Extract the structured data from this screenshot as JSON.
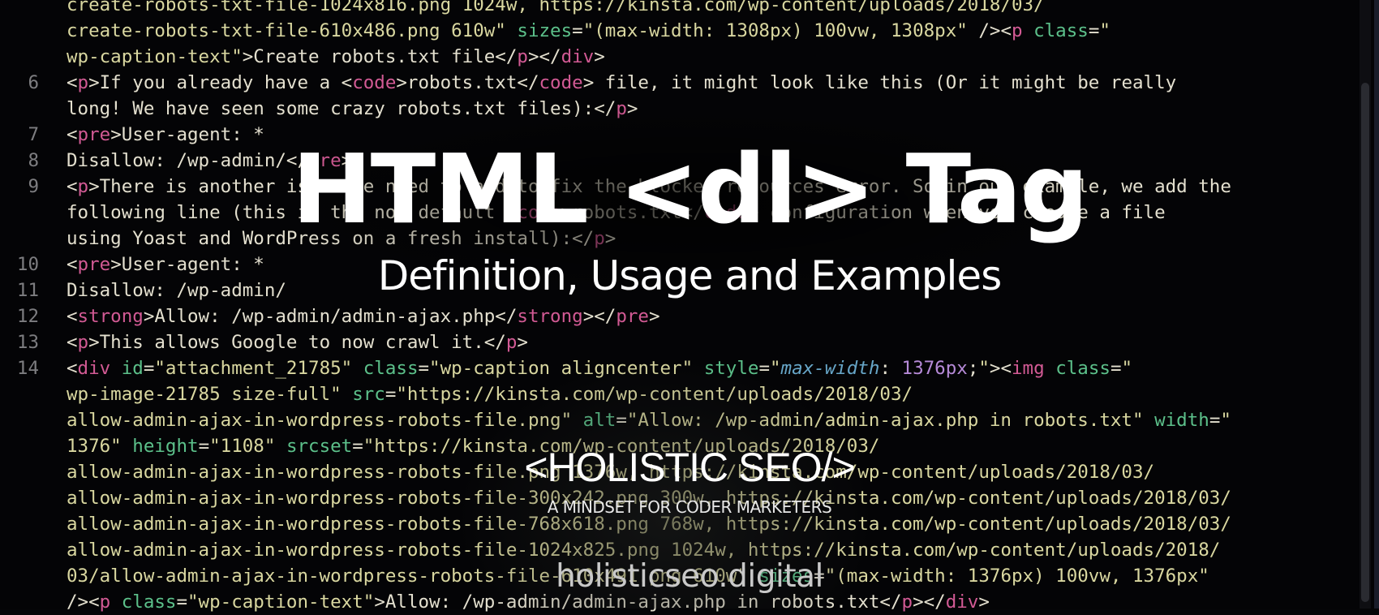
{
  "banner": {
    "title": "HTML <dl> Tag",
    "subtitle": "Definition, Usage and Examples",
    "brand": "<HOLISTIC SEO/>",
    "tagline": "A MINDSET FOR CODER  MARKETERS",
    "domain": "holisticseo.digital"
  },
  "colors": {
    "background": "#040406",
    "string": "#d9d7a0",
    "tag": "#d25a94",
    "attribute": "#5cc08a",
    "line_number": "#7d7d80",
    "title_text": "#ffffff"
  },
  "code": {
    "lines": [
      {
        "num": "",
        "segments": [
          {
            "c": "s",
            "t": "create-robots-txt-file-1024x816.png 1024w, https://kinsta.com/wp-content/uploads/2018/03/"
          }
        ]
      },
      {
        "num": "",
        "segments": [
          {
            "c": "s",
            "t": "create-robots-txt-file-610x486.png 610w\" "
          },
          {
            "c": "a",
            "t": "sizes"
          },
          {
            "c": "p",
            "t": "="
          },
          {
            "c": "s",
            "t": "\"(max-width: 1308px) 100vw, 1308px\" "
          },
          {
            "c": "p",
            "t": "/><"
          },
          {
            "c": "t",
            "t": "p"
          },
          {
            "c": "a",
            "t": " class"
          },
          {
            "c": "p",
            "t": "="
          },
          {
            "c": "s",
            "t": "\""
          }
        ]
      },
      {
        "num": "",
        "segments": [
          {
            "c": "s",
            "t": "wp-caption-text\""
          },
          {
            "c": "p",
            "t": ">Create robots.txt file</"
          },
          {
            "c": "t",
            "t": "p"
          },
          {
            "c": "p",
            "t": "></"
          },
          {
            "c": "t",
            "t": "div"
          },
          {
            "c": "p",
            "t": ">"
          }
        ]
      },
      {
        "num": "6",
        "segments": [
          {
            "c": "p",
            "t": "<"
          },
          {
            "c": "t",
            "t": "p"
          },
          {
            "c": "p",
            "t": ">If you already have a <"
          },
          {
            "c": "t",
            "t": "code"
          },
          {
            "c": "p",
            "t": ">robots.txt</"
          },
          {
            "c": "t",
            "t": "code"
          },
          {
            "c": "p",
            "t": "> file, it might look like this (Or it might be really"
          }
        ]
      },
      {
        "num": "",
        "segments": [
          {
            "c": "p",
            "t": "long! We have seen some crazy robots.txt files):</"
          },
          {
            "c": "t",
            "t": "p"
          },
          {
            "c": "p",
            "t": ">"
          }
        ]
      },
      {
        "num": "7",
        "segments": [
          {
            "c": "p",
            "t": "<"
          },
          {
            "c": "t",
            "t": "pre"
          },
          {
            "c": "p",
            "t": ">User-agent: *"
          }
        ]
      },
      {
        "num": "8",
        "segments": [
          {
            "c": "p",
            "t": "Disallow: /wp-admin/</"
          },
          {
            "c": "t",
            "t": "pre"
          },
          {
            "c": "p",
            "t": ">"
          }
        ]
      },
      {
        "num": "9",
        "segments": [
          {
            "c": "p",
            "t": "<"
          },
          {
            "c": "t",
            "t": "p"
          },
          {
            "c": "p",
            "t": ">There is another issue we need to add to fix the blocked resources error. So in our example, we add the"
          }
        ]
      },
      {
        "num": "",
        "segments": [
          {
            "c": "p",
            "t": "following line (this is the now default <"
          },
          {
            "c": "t",
            "t": "code"
          },
          {
            "c": "p",
            "t": ">robots.txt</"
          },
          {
            "c": "t",
            "t": "code"
          },
          {
            "c": "p",
            "t": "> configuration when you create a file"
          }
        ]
      },
      {
        "num": "",
        "segments": [
          {
            "c": "p",
            "t": "using Yoast and WordPress on a fresh install):</"
          },
          {
            "c": "t",
            "t": "p"
          },
          {
            "c": "p",
            "t": ">"
          }
        ]
      },
      {
        "num": "10",
        "segments": [
          {
            "c": "p",
            "t": "<"
          },
          {
            "c": "t",
            "t": "pre"
          },
          {
            "c": "p",
            "t": ">User-agent: *"
          }
        ]
      },
      {
        "num": "11",
        "segments": [
          {
            "c": "p",
            "t": "Disallow: /wp-admin/"
          }
        ]
      },
      {
        "num": "12",
        "segments": [
          {
            "c": "p",
            "t": "<"
          },
          {
            "c": "t",
            "t": "strong"
          },
          {
            "c": "p",
            "t": ">Allow: /wp-admin/admin-ajax.php</"
          },
          {
            "c": "t",
            "t": "strong"
          },
          {
            "c": "p",
            "t": "></"
          },
          {
            "c": "t",
            "t": "pre"
          },
          {
            "c": "p",
            "t": ">"
          }
        ]
      },
      {
        "num": "13",
        "segments": [
          {
            "c": "p",
            "t": "<"
          },
          {
            "c": "t",
            "t": "p"
          },
          {
            "c": "p",
            "t": ">This allows Google to now crawl it.</"
          },
          {
            "c": "t",
            "t": "p"
          },
          {
            "c": "p",
            "t": ">"
          }
        ]
      },
      {
        "num": "14",
        "segments": [
          {
            "c": "p",
            "t": "<"
          },
          {
            "c": "t",
            "t": "div"
          },
          {
            "c": "a",
            "t": " id"
          },
          {
            "c": "p",
            "t": "="
          },
          {
            "c": "s",
            "t": "\"attachment_21785\" "
          },
          {
            "c": "a",
            "t": "class"
          },
          {
            "c": "p",
            "t": "="
          },
          {
            "c": "s",
            "t": "\"wp-caption aligncenter\" "
          },
          {
            "c": "a",
            "t": "style"
          },
          {
            "c": "p",
            "t": "="
          },
          {
            "c": "s",
            "t": "\""
          },
          {
            "c": "k",
            "t": "max-width"
          },
          {
            "c": "p",
            "t": ": "
          },
          {
            "c": "n",
            "t": "1376px"
          },
          {
            "c": "p",
            "t": ";"
          },
          {
            "c": "s",
            "t": "\""
          },
          {
            "c": "p",
            "t": "><"
          },
          {
            "c": "t",
            "t": "img"
          },
          {
            "c": "a",
            "t": " class"
          },
          {
            "c": "p",
            "t": "="
          },
          {
            "c": "s",
            "t": "\""
          }
        ]
      },
      {
        "num": "",
        "segments": [
          {
            "c": "s",
            "t": "wp-image-21785 size-full\" "
          },
          {
            "c": "a",
            "t": "src"
          },
          {
            "c": "p",
            "t": "="
          },
          {
            "c": "s",
            "t": "\"https://kinsta.com/wp-content/uploads/2018/03/"
          }
        ]
      },
      {
        "num": "",
        "segments": [
          {
            "c": "s",
            "t": "allow-admin-ajax-in-wordpress-robots-file.png\" "
          },
          {
            "c": "a",
            "t": "alt"
          },
          {
            "c": "p",
            "t": "="
          },
          {
            "c": "s",
            "t": "\"Allow: /wp-admin/admin-ajax.php in robots.txt\" "
          },
          {
            "c": "a",
            "t": "width"
          },
          {
            "c": "p",
            "t": "="
          },
          {
            "c": "s",
            "t": "\""
          }
        ]
      },
      {
        "num": "",
        "segments": [
          {
            "c": "s",
            "t": "1376\" "
          },
          {
            "c": "a",
            "t": "height"
          },
          {
            "c": "p",
            "t": "="
          },
          {
            "c": "s",
            "t": "\"1108\" "
          },
          {
            "c": "a",
            "t": "srcset"
          },
          {
            "c": "p",
            "t": "="
          },
          {
            "c": "s",
            "t": "\"https://kinsta.com/wp-content/uploads/2018/03/"
          }
        ]
      },
      {
        "num": "",
        "segments": [
          {
            "c": "s",
            "t": "allow-admin-ajax-in-wordpress-robots-file.png 1376w, https://kinsta.com/wp-content/uploads/2018/03/"
          }
        ]
      },
      {
        "num": "",
        "segments": [
          {
            "c": "s",
            "t": "allow-admin-ajax-in-wordpress-robots-file-300x242.png 300w, https://kinsta.com/wp-content/uploads/2018/03/"
          }
        ]
      },
      {
        "num": "",
        "segments": [
          {
            "c": "s",
            "t": "allow-admin-ajax-in-wordpress-robots-file-768x618.png 768w, https://kinsta.com/wp-content/uploads/2018/03/"
          }
        ]
      },
      {
        "num": "",
        "segments": [
          {
            "c": "s",
            "t": "allow-admin-ajax-in-wordpress-robots-file-1024x825.png 1024w, https://kinsta.com/wp-content/uploads/2018/"
          }
        ]
      },
      {
        "num": "",
        "segments": [
          {
            "c": "s",
            "t": "03/allow-admin-ajax-in-wordpress-robots-file-610x491.png 610w\" "
          },
          {
            "c": "a",
            "t": "sizes"
          },
          {
            "c": "p",
            "t": "="
          },
          {
            "c": "s",
            "t": "\"(max-width: 1376px) 100vw, 1376px\""
          }
        ]
      },
      {
        "num": "",
        "segments": [
          {
            "c": "p",
            "t": "/><"
          },
          {
            "c": "t",
            "t": "p"
          },
          {
            "c": "a",
            "t": " class"
          },
          {
            "c": "p",
            "t": "="
          },
          {
            "c": "s",
            "t": "\"wp-caption-text\""
          },
          {
            "c": "p",
            "t": ">Allow: /wp-admin/admin-ajax.php in robots.txt</"
          },
          {
            "c": "t",
            "t": "p"
          },
          {
            "c": "p",
            "t": "></"
          },
          {
            "c": "t",
            "t": "div"
          },
          {
            "c": "p",
            "t": ">"
          }
        ]
      }
    ]
  }
}
